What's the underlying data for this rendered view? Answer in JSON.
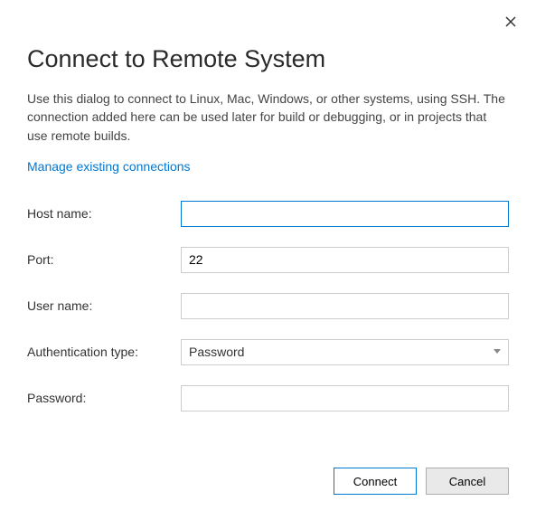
{
  "dialog": {
    "title": "Connect to Remote System",
    "description": "Use this dialog to connect to Linux, Mac, Windows, or other systems, using SSH. The connection added here can be used later for build or debugging, or in projects that use remote builds.",
    "link_text": "Manage existing connections"
  },
  "form": {
    "host_name": {
      "label": "Host name:",
      "value": ""
    },
    "port": {
      "label": "Port:",
      "value": "22"
    },
    "user_name": {
      "label": "User name:",
      "value": ""
    },
    "auth_type": {
      "label": "Authentication type:",
      "value": "Password"
    },
    "password": {
      "label": "Password:",
      "value": ""
    }
  },
  "buttons": {
    "connect": "Connect",
    "cancel": "Cancel"
  }
}
